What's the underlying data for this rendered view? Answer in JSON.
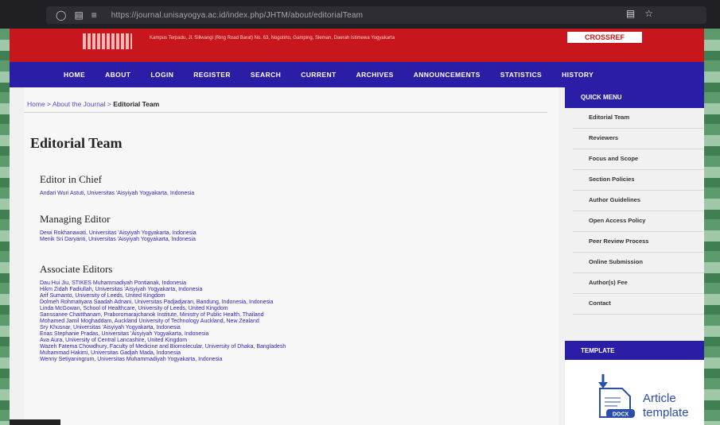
{
  "browser": {
    "url": "https://journal.unisayogya.ac.id/index.php/JHTM/about/editorialTeam"
  },
  "header": {
    "subtext": "Kampus Terpadu, Jl. Siliwangi (Ring Road Barat) No. 63, Nogotirto, Gamping, Sleman, Daerah Istimewa Yogyakarta",
    "button": "CROSSREF"
  },
  "nav": [
    "HOME",
    "ABOUT",
    "LOGIN",
    "REGISTER",
    "SEARCH",
    "CURRENT",
    "ARCHIVES",
    "ANNOUNCEMENTS",
    "STATISTICS",
    "HISTORY"
  ],
  "breadcrumb": {
    "home": "Home",
    "sep1": " > ",
    "about": "About the Journal",
    "sep2": " > ",
    "current": "Editorial Team"
  },
  "page_title": "Editorial Team",
  "sections": {
    "chief": {
      "title": "Editor in Chief",
      "members": [
        "Andari Wuri Astuti, Universitas 'Aisyiyah Yogyakarta, Indonesia"
      ]
    },
    "managing": {
      "title": "Managing Editor",
      "members": [
        "Dewi Rokhanawati, Universitas 'Aisyiyah Yogyakarta, Indonesia",
        "Menik Sri Daryanti, Universitas 'Aisyiyah Yogyakarta, Indonesia"
      ]
    },
    "associate": {
      "title": "Associate Editors",
      "members": [
        "Dau Hui Jiu, STIKES Muhammadiyah Pontianak, Indonesia",
        "Hikm Zidah Fadiullah, Universitas 'Aisyiyah Yogyakarta, Indonesia",
        "Arif Sumanto, University of Leeds, United Kingdom",
        "Dolmeh Rohmatiyara Saadah Adnani, Universitas Padjadjaran, Bandung, Indonesia, Indonesia",
        "Linda McGowan, School of Healthcare, University of Leeds, United Kingdom",
        "Sanssanee Chaitthanam, Praboromarajchanok Institute, Ministry of Public Health, Thailand",
        "Mohamed Jamil Moghaddam, Auckland University of Technology Auckland, New Zealand",
        "Sry Khusnar, Universitas 'Aisyiyah Yogyakarta, Indonesia",
        "Enas Stephanie Pradas, Universitas 'Aisyiyah Yogyakarta, Indonesia",
        "Ava Aura, University of Central Lancashire, United Kingdom",
        "Wazeh Fatema Chowdhury, Faculty of Medicine and Biomolecular, University of Dhaka, Bangladesh",
        "Muhammad Hakimi, Universitas Gadjah Mada, Indonesia",
        "Wenny Setiyaningrum, Universitas Muhammadiyah Yogyakarta, Indonesia"
      ]
    }
  },
  "sidebar": {
    "quick_menu_title": "QUICK MENU",
    "quick_menu": [
      "Editorial Team",
      "Reviewers",
      "Focus and Scope",
      "Section Policies",
      "Author Guidelines",
      "Open Access Policy",
      "Peer Review Process",
      "Online Submission",
      "Author(s) Fee",
      "Contact"
    ],
    "template_title": "TEMPLATE",
    "template_label_1": "Article",
    "template_label_2": "template",
    "template_badge": "DOCX"
  },
  "colors": {
    "header_red": "#c8171c",
    "nav_blue": "#2a1ea6",
    "link_blue": "#2d1fb0"
  }
}
